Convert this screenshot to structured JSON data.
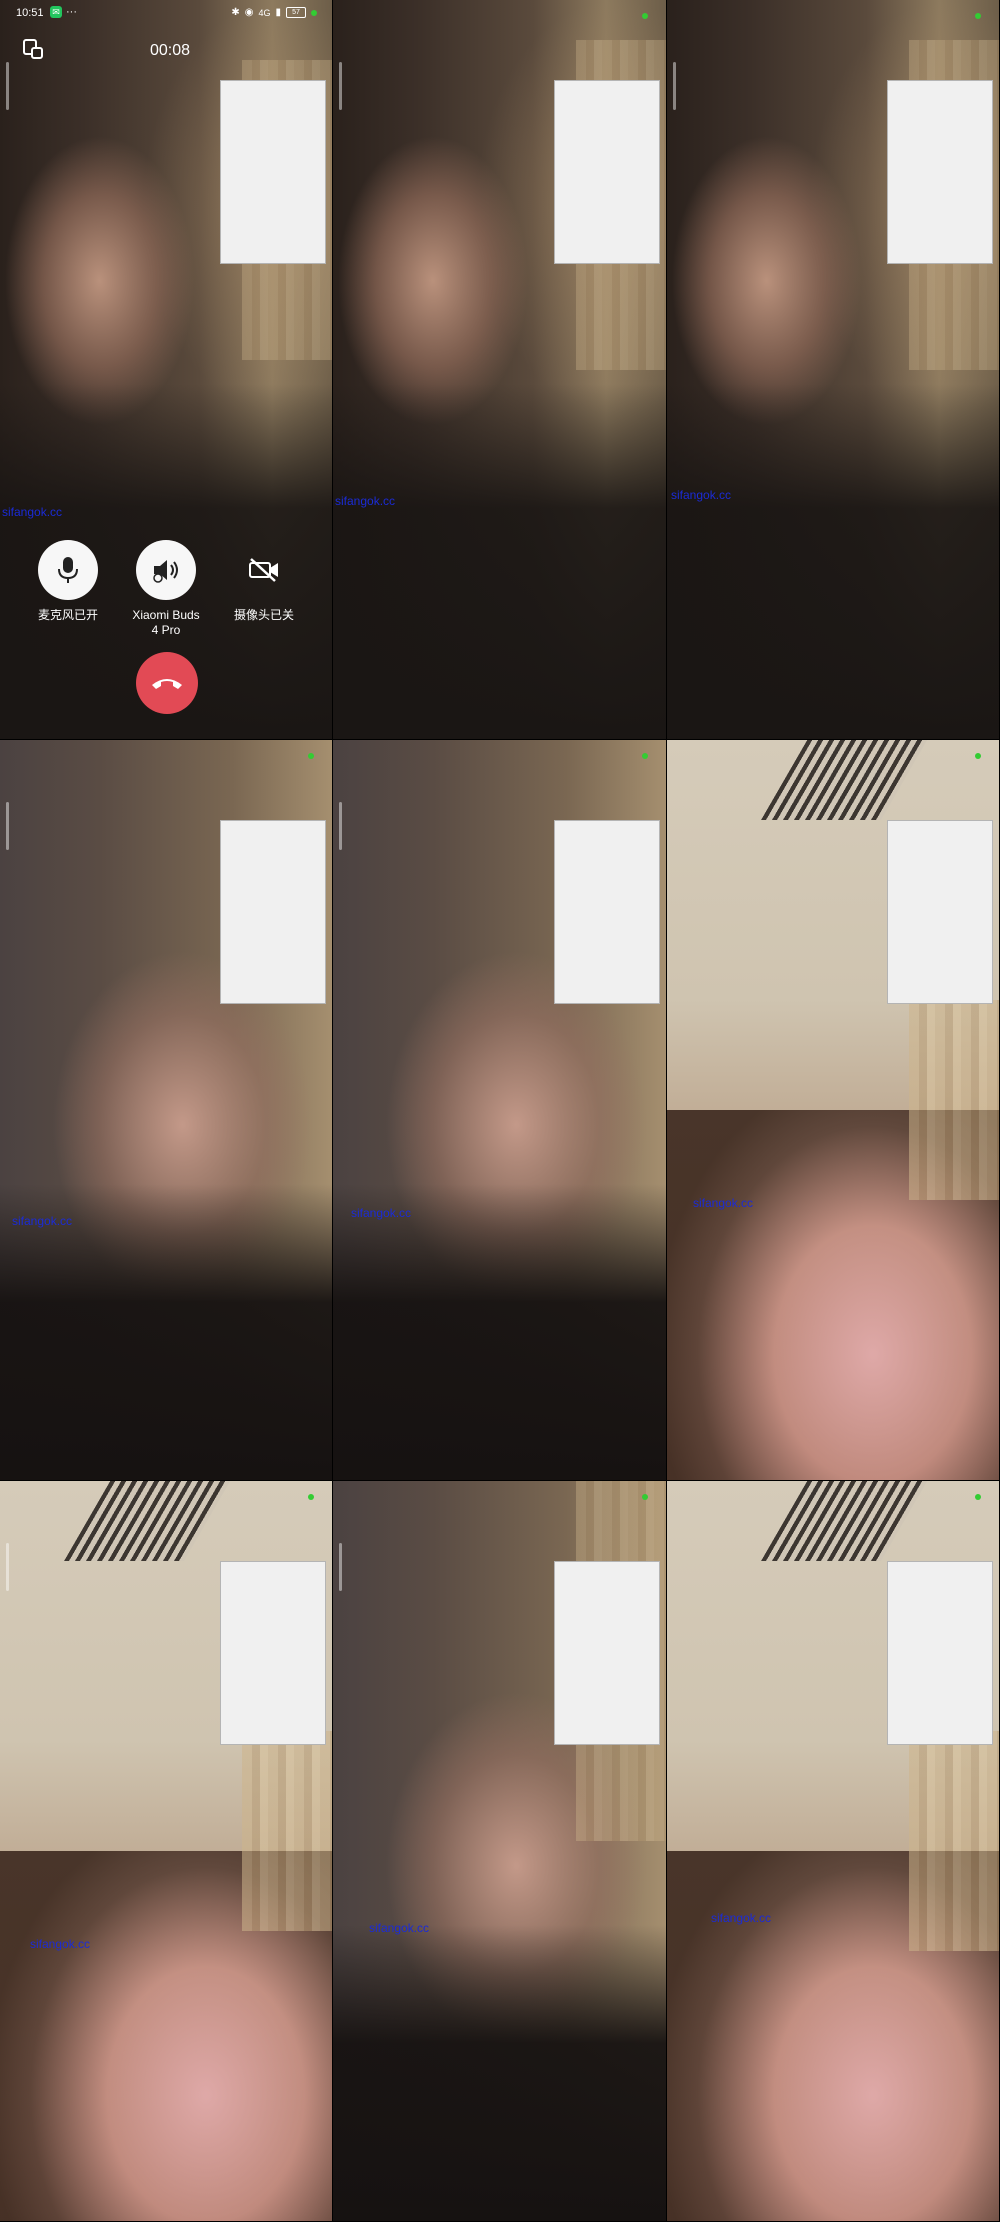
{
  "status_bar": {
    "time": "10:51",
    "notif_dots": "···",
    "network": "4G",
    "battery": "57"
  },
  "call": {
    "timer": "00:08",
    "mic_label": "麦克风已开",
    "audio_label": "Xiaomi Buds\n4 Pro",
    "camera_label": "摄像头已关"
  },
  "watermark": "sifangok.cc",
  "icons": [
    "float-window-icon",
    "mic-icon",
    "speaker-icon",
    "camera-off-icon",
    "hangup-icon"
  ],
  "colors": {
    "hangup": "#e24a55",
    "indicator": "#33cc33",
    "watermark": "#1b2bd6"
  }
}
